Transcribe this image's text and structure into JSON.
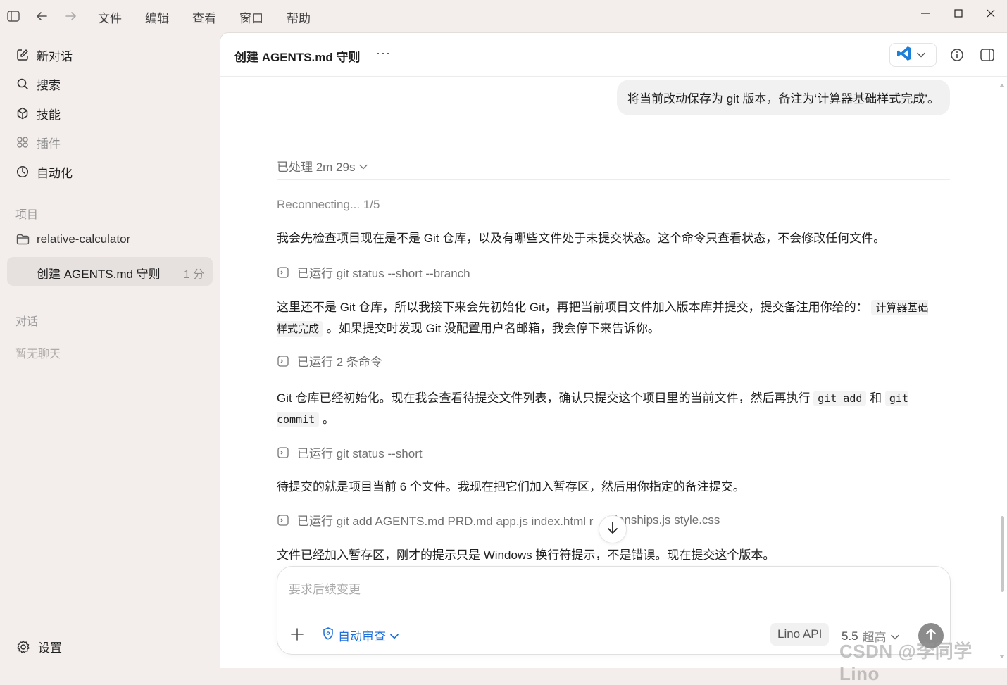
{
  "menu": [
    "文件",
    "编辑",
    "查看",
    "窗口",
    "帮助"
  ],
  "sidebar": {
    "nav": [
      {
        "label": "新对话",
        "icon": "new-chat-icon"
      },
      {
        "label": "搜索",
        "icon": "search-icon"
      },
      {
        "label": "技能",
        "icon": "skills-icon"
      },
      {
        "label": "插件",
        "icon": "plugins-icon"
      },
      {
        "label": "自动化",
        "icon": "clock-icon"
      }
    ],
    "projects_label": "项目",
    "project_name": "relative-calculator",
    "active_thread": {
      "title": "创建 AGENTS.md 守则",
      "time": "1 分"
    },
    "chats_label": "对话",
    "empty_chats": "暂无聊天",
    "settings_label": "设置"
  },
  "header": {
    "title": "创建 AGENTS.md 守则",
    "more": "···"
  },
  "conversation": {
    "user_message": "将当前改动保存为 git 版本，备注为‘计算器基础样式完成’。",
    "processed": "已处理 2m 29s",
    "reconnecting": "Reconnecting... 1/5",
    "p1": "我会先检查项目现在是不是 Git 仓库，以及有哪些文件处于未提交状态。这个命令只查看状态，不会修改任何文件。",
    "ran1": "已运行 git status --short --branch",
    "p2_a": "这里还不是 Git 仓库，所以我接下来会先初始化 Git，再把当前项目文件加入版本库并提交，提交备注用你给的：",
    "p2_code": "计算器基础样式完成",
    "p2_b": "。如果提交时发现 Git 没配置用户名邮箱，我会停下来告诉你。",
    "ran2": "已运行 2 条命令",
    "p3_a": "Git 仓库已经初始化。现在我会查看待提交文件列表，确认只提交这个项目里的当前文件，然后再执行",
    "p3_code1": "git add",
    "p3_b": "和",
    "p3_code2": "git commit",
    "p3_c": "。",
    "ran3": "已运行 git status --short",
    "p4": "待提交的就是项目当前 6 个文件。我现在把它们加入暂存区，然后用你指定的备注提交。",
    "ran4_a": "已运行 git add AGENTS.md PRD.md app.js index.html r",
    "ran4_b": "tionships.js style.css",
    "p5": "文件已经加入暂存区，刚才的提示只是 Windows 换行符提示，不是错误。现在提交这个版本。"
  },
  "composer": {
    "placeholder": "要求后续变更",
    "review_label": "自动审查",
    "api_label": "Lino API",
    "model_version": "5.5",
    "model_mode": "超高"
  },
  "watermark": "CSDN @李同学Lino",
  "colors": {
    "accent": "#1e6fd9",
    "sidebar_bg": "#f3eeec",
    "vscode_blue": "#1f7fd6"
  }
}
